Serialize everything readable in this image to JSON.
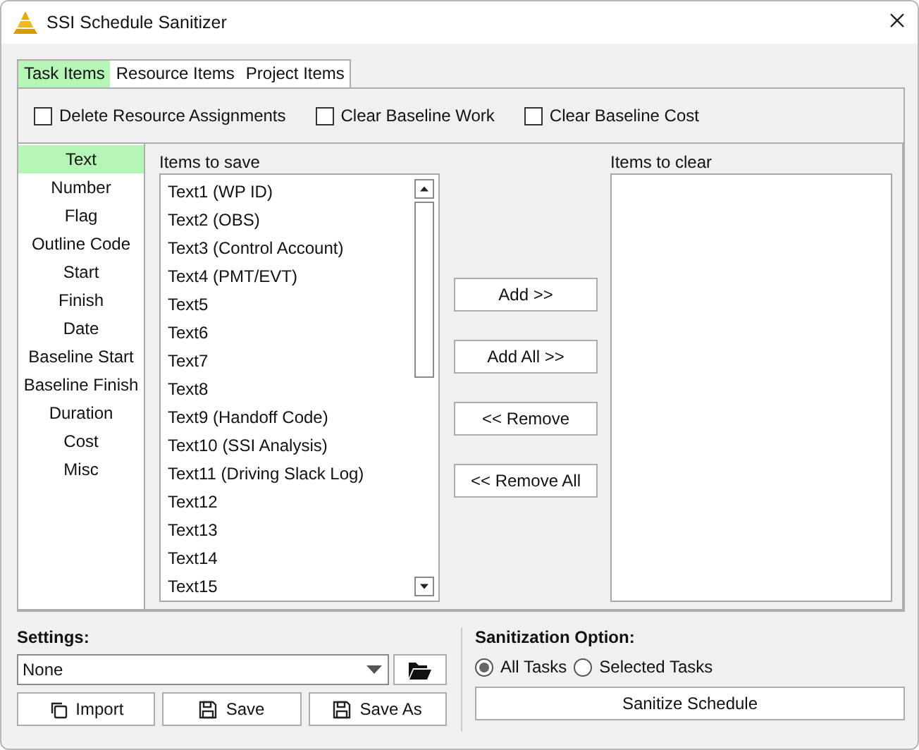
{
  "window": {
    "title": "SSI Schedule Sanitizer"
  },
  "tabs": [
    {
      "label": "Task Items",
      "selected": true
    },
    {
      "label": "Resource Items",
      "selected": false
    },
    {
      "label": "Project Items",
      "selected": false
    }
  ],
  "options": [
    {
      "label": "Delete Resource Assignments",
      "checked": false
    },
    {
      "label": "Clear Baseline Work",
      "checked": false
    },
    {
      "label": "Clear Baseline Cost",
      "checked": false
    }
  ],
  "categories": [
    {
      "label": "Text",
      "selected": true
    },
    {
      "label": "Number",
      "selected": false
    },
    {
      "label": "Flag",
      "selected": false
    },
    {
      "label": "Outline Code",
      "selected": false
    },
    {
      "label": "Start",
      "selected": false
    },
    {
      "label": "Finish",
      "selected": false
    },
    {
      "label": "Date",
      "selected": false
    },
    {
      "label": "Baseline Start",
      "selected": false
    },
    {
      "label": "Baseline Finish",
      "selected": false
    },
    {
      "label": "Duration",
      "selected": false
    },
    {
      "label": "Cost",
      "selected": false
    },
    {
      "label": "Misc",
      "selected": false
    }
  ],
  "items_to_save": {
    "label": "Items to save",
    "items": [
      "Text1 (WP ID)",
      "Text2 (OBS)",
      "Text3 (Control Account)",
      "Text4 (PMT/EVT)",
      "Text5",
      "Text6",
      "Text7",
      "Text8",
      "Text9 (Handoff Code)",
      "Text10 (SSI Analysis)",
      "Text11 (Driving Slack Log)",
      "Text12",
      "Text13",
      "Text14",
      "Text15"
    ]
  },
  "transfer_buttons": [
    "Add >>",
    "Add All >>",
    "<< Remove",
    "<< Remove All"
  ],
  "items_to_clear": {
    "label": "Items to clear"
  },
  "settings": {
    "label": "Settings:",
    "value": "None",
    "buttons": [
      {
        "label": "Import",
        "kind": "import"
      },
      {
        "label": "Save",
        "kind": "save"
      },
      {
        "label": "Save As",
        "kind": "save"
      }
    ]
  },
  "sanitization": {
    "label": "Sanitization Option:",
    "options": [
      {
        "label": "All Tasks",
        "selected": true
      },
      {
        "label": "Selected Tasks",
        "selected": false
      }
    ],
    "button": "Sanitize Schedule"
  }
}
